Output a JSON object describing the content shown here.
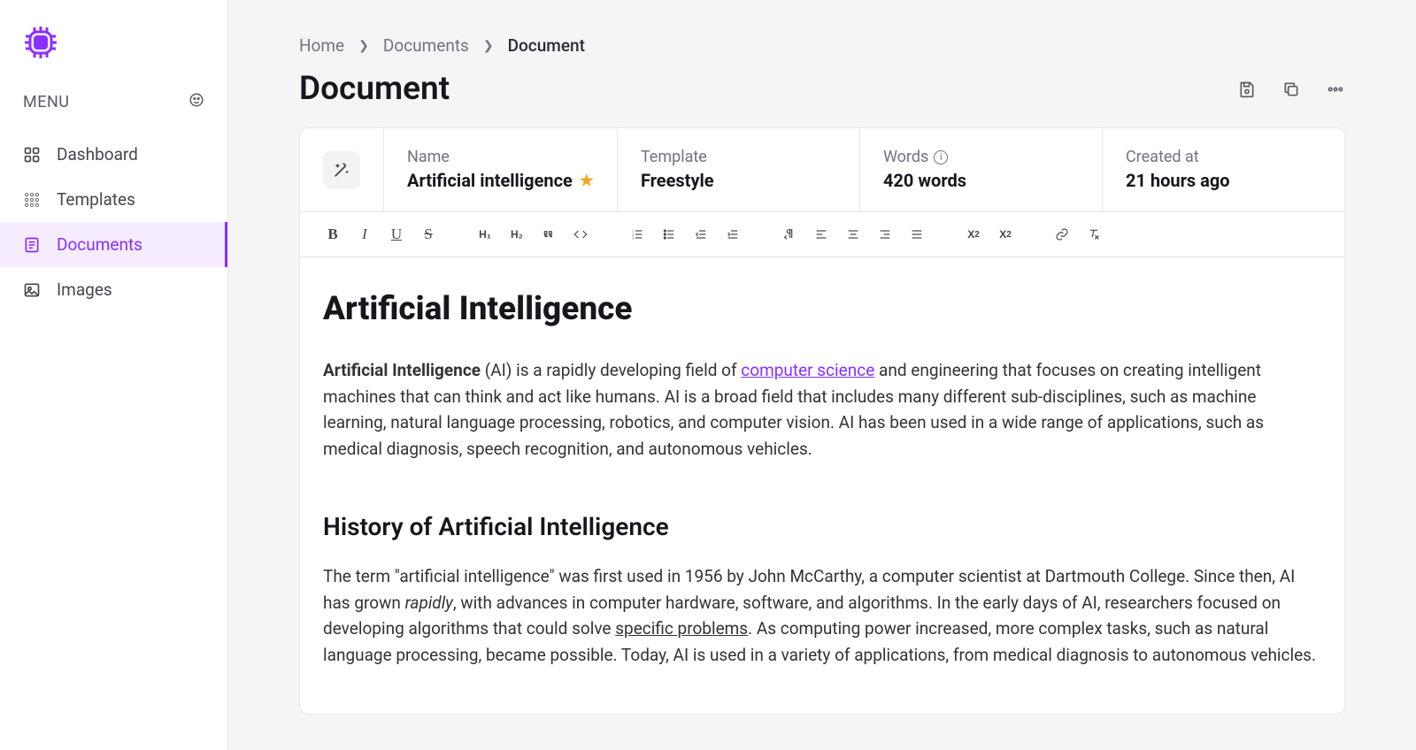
{
  "sidebar": {
    "menu_label": "MENU",
    "items": [
      {
        "label": "Dashboard",
        "icon": "dashboard",
        "active": false
      },
      {
        "label": "Templates",
        "icon": "templates",
        "active": false
      },
      {
        "label": "Documents",
        "icon": "documents",
        "active": true
      },
      {
        "label": "Images",
        "icon": "images",
        "active": false
      }
    ]
  },
  "breadcrumb": {
    "items": [
      {
        "label": "Home",
        "current": false
      },
      {
        "label": "Documents",
        "current": false
      },
      {
        "label": "Document",
        "current": true
      }
    ]
  },
  "page_title": "Document",
  "meta": {
    "name": {
      "label": "Name",
      "value": "Artificial intelligence",
      "favorite": true
    },
    "template": {
      "label": "Template",
      "value": "Freestyle"
    },
    "words": {
      "label": "Words",
      "value": "420 words",
      "info": true
    },
    "created": {
      "label": "Created at",
      "value": "21 hours ago"
    }
  },
  "content": {
    "h1": "Artificial Intelligence",
    "p1_bold": "Artificial Intelligence",
    "p1_text1": " (AI) is a rapidly developing field of ",
    "p1_link": "computer science",
    "p1_text2": " and engineering that focuses on creating intelligent machines that can think and act like humans. AI is a broad field that includes many different sub-disciplines, such as machine learning, natural language processing, robotics, and computer vision. AI has been used in a wide range of applications, such as medical diagnosis, speech recognition, and autonomous vehicles.",
    "h2": "History of Artificial Intelligence",
    "p2_text1": "The term \"artificial intelligence\" was first used in 1956 by John McCarthy, a computer scientist at Dartmouth College. Since then, AI has grown ",
    "p2_em": "rapidly",
    "p2_text2": ", with advances in computer hardware, software, and algorithms. In the early days of AI, researchers focused on developing algorithms that could solve ",
    "p2_u": "specific problems",
    "p2_text3": ". As computing power increased, more complex tasks, such as natural language processing, became possible. Today, AI is used in a variety of applications, from medical diagnosis to autonomous vehicles."
  }
}
